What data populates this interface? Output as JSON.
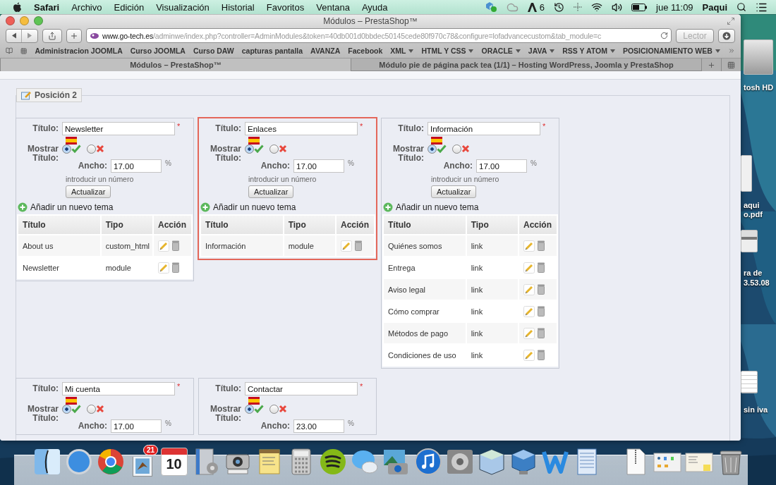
{
  "menu_bar": {
    "app_name": "Safari",
    "menus": [
      "Archivo",
      "Edición",
      "Visualización",
      "Historial",
      "Favoritos",
      "Ventana",
      "Ayuda"
    ],
    "status": {
      "adobe_count": "6",
      "clock": "jue 11:09",
      "user": "Paqui"
    }
  },
  "window": {
    "title": "Módulos – PrestaShop™"
  },
  "toolbar": {
    "address": {
      "host": "www.go-tech.es",
      "path": "/adminwe/index.php?controller=AdminModules&token=40db001d0bbdec50145cede80f970c78&configure=lofadvancecustom&tab_module=c"
    },
    "reader": {
      "label": "Lector",
      "disabled": true
    }
  },
  "bookmarks": [
    {
      "label": "Administracion JOOMLA",
      "menu": false
    },
    {
      "label": "Curso JOOMLA",
      "menu": false
    },
    {
      "label": "Curso DAW",
      "menu": false
    },
    {
      "label": "capturas pantalla",
      "menu": false
    },
    {
      "label": "AVANZA",
      "menu": false
    },
    {
      "label": "Facebook",
      "menu": false
    },
    {
      "label": "XML",
      "menu": true
    },
    {
      "label": "HTML Y CSS",
      "menu": true
    },
    {
      "label": "ORACLE",
      "menu": true
    },
    {
      "label": "JAVA",
      "menu": true
    },
    {
      "label": "RSS Y ATOM",
      "menu": true
    },
    {
      "label": "POSICIONAMIENTO WEB",
      "menu": true
    }
  ],
  "tabs": [
    {
      "label": "Módulos – PrestaShop™",
      "selected": true
    },
    {
      "label": "Módulo pie de página pack tea (1/1) – Hosting WordPress, Joomla y PrestaShop",
      "selected": false
    }
  ],
  "panel": {
    "legend": "Posición 2"
  },
  "cards": [
    {
      "highlighted": false,
      "labels": {
        "title": "Título:",
        "required": "*",
        "show": "Mostrar Título:",
        "width": "Ancho:",
        "unit": "%"
      },
      "title_value": "Newsletter",
      "show_title": true,
      "width_value": "17.00",
      "hint": "introducir un número",
      "button": "Actualizar",
      "add_link": "Añadir un nuevo tema",
      "table": {
        "columns": [
          "Título",
          "Tipo",
          "Acción"
        ],
        "rows": [
          {
            "title": "About us",
            "type": "custom_html"
          },
          {
            "title": "Newsletter",
            "type": "module"
          }
        ]
      }
    },
    {
      "highlighted": true,
      "labels": {
        "title": "Título:",
        "required": "*",
        "show": "Mostrar Título:",
        "width": "Ancho:",
        "unit": "%"
      },
      "title_value": "Enlaces",
      "show_title": true,
      "width_value": "17.00",
      "hint": "introducir un número",
      "button": "Actualizar",
      "add_link": "Añadir un nuevo tema",
      "table": {
        "columns": [
          "Título",
          "Tipo",
          "Acción"
        ],
        "rows": [
          {
            "title": "Información",
            "type": "module"
          }
        ]
      }
    },
    {
      "highlighted": false,
      "labels": {
        "title": "Título:",
        "required": "*",
        "show": "Mostrar Título:",
        "width": "Ancho:",
        "unit": "%"
      },
      "title_value": "Información",
      "show_title": true,
      "width_value": "17.00",
      "hint": "introducir un número",
      "button": "Actualizar",
      "add_link": "Añadir un nuevo tema",
      "table": {
        "columns": [
          "Título",
          "Tipo",
          "Acción"
        ],
        "rows": [
          {
            "title": "Quiénes somos",
            "type": "link"
          },
          {
            "title": "Entrega",
            "type": "link"
          },
          {
            "title": "Aviso legal",
            "type": "link"
          },
          {
            "title": "Cómo comprar",
            "type": "link"
          },
          {
            "title": "Métodos de pago",
            "type": "link"
          },
          {
            "title": "Condiciones de uso",
            "type": "link"
          }
        ]
      }
    },
    {
      "highlighted": false,
      "labels": {
        "title": "Título:",
        "required": "*",
        "show": "Mostrar Título:",
        "width": "Ancho:",
        "unit": "%"
      },
      "title_value": "Mi cuenta",
      "show_title": true,
      "width_value": "17.00"
    },
    {
      "highlighted": false,
      "labels": {
        "title": "Título:",
        "required": "*",
        "show": "Mostrar Título:",
        "width": "Ancho:",
        "unit": "%"
      },
      "title_value": "Contactar",
      "show_title": true,
      "width_value": "23.00"
    }
  ],
  "desktop_items": [
    {
      "kind": "drive",
      "label_lines": [
        "tosh HD"
      ]
    },
    {
      "kind": "document",
      "label_lines": [
        "aqui",
        "o.pdf"
      ]
    },
    {
      "kind": "screenshot",
      "label_lines": [
        "ra de",
        "3.53.08"
      ]
    },
    {
      "kind": "spreadsheet",
      "label_lines": [
        "sin iva"
      ]
    }
  ],
  "dock": {
    "mail_badge": "21",
    "calendar_day": "10"
  }
}
